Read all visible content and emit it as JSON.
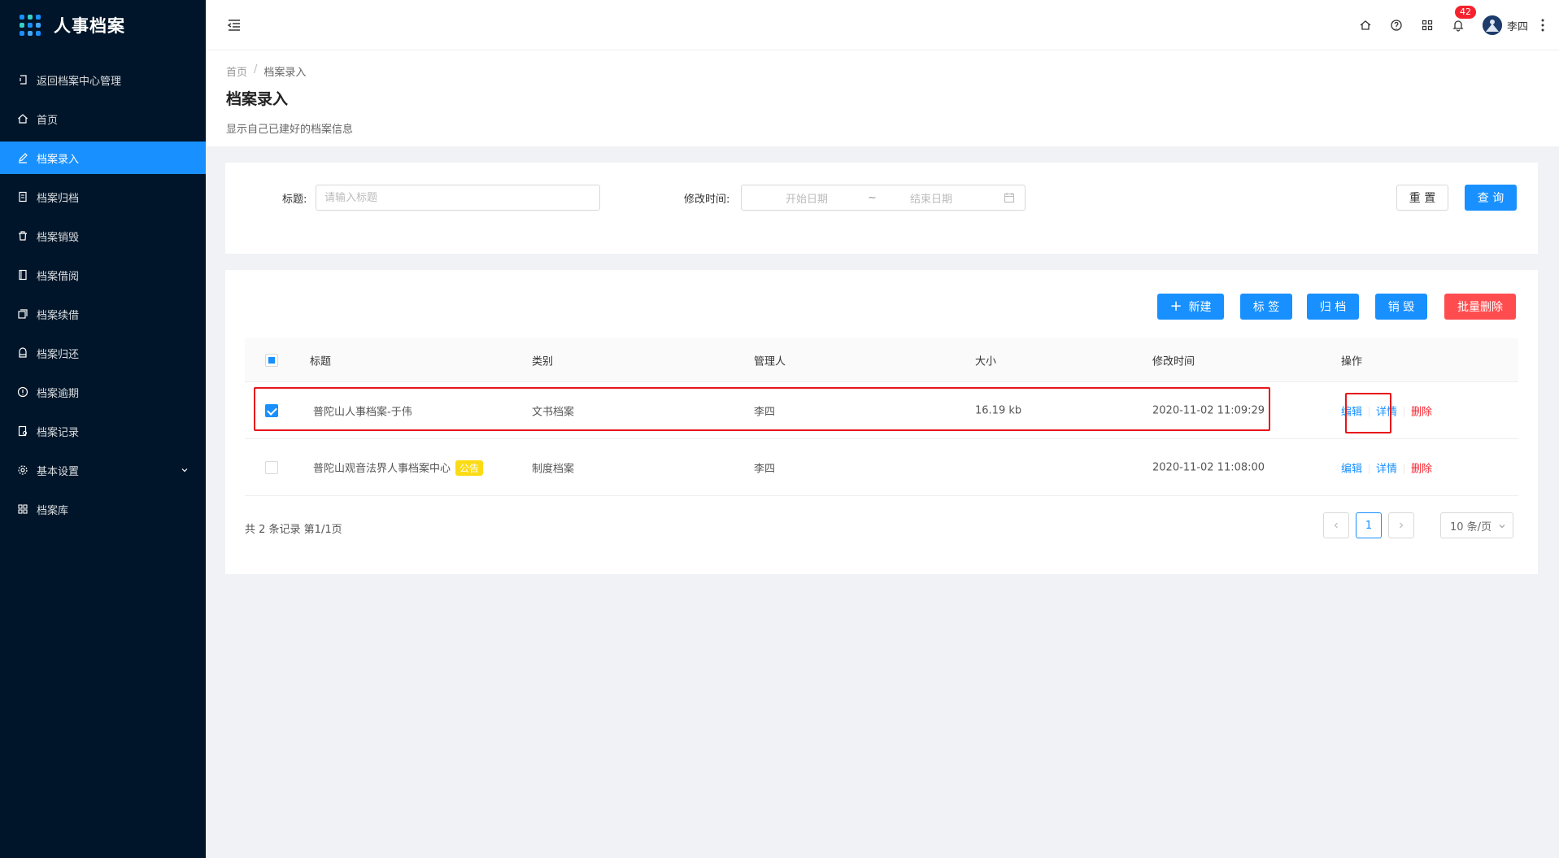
{
  "app": {
    "title": "人事档案"
  },
  "sidebar": {
    "items": [
      {
        "label": "返回档案中心管理",
        "icon": "return-icon"
      },
      {
        "label": "首页",
        "icon": "home-icon"
      },
      {
        "label": "档案录入",
        "icon": "edit-icon",
        "active": true
      },
      {
        "label": "档案归档",
        "icon": "file-icon"
      },
      {
        "label": "档案销毁",
        "icon": "trash-icon"
      },
      {
        "label": "档案借阅",
        "icon": "book-icon"
      },
      {
        "label": "档案续借",
        "icon": "copy-icon"
      },
      {
        "label": "档案归还",
        "icon": "inbox-icon"
      },
      {
        "label": "档案逾期",
        "icon": "alert-icon"
      },
      {
        "label": "档案记录",
        "icon": "record-icon"
      },
      {
        "label": "基本设置",
        "icon": "gear-icon",
        "expandable": true
      },
      {
        "label": "档案库",
        "icon": "grid-icon"
      }
    ]
  },
  "header": {
    "notification_count": "42",
    "username": "李四"
  },
  "page": {
    "breadcrumb": [
      "首页",
      "/",
      "档案录入"
    ],
    "title": "档案录入",
    "description": "显示自己已建好的档案信息"
  },
  "search": {
    "title_label": "标题:",
    "title_placeholder": "请输入标题",
    "time_label": "修改时间:",
    "start_placeholder": "开始日期",
    "range_sep": "~",
    "end_placeholder": "结束日期",
    "reset_label": "重 置",
    "query_label": "查 询"
  },
  "toolbar": {
    "new_label": "新建",
    "tag_label": "标 签",
    "archive_label": "归 档",
    "destroy_label": "销 毁",
    "batch_delete_label": "批量删除"
  },
  "table": {
    "columns": [
      "标题",
      "类别",
      "管理人",
      "大小",
      "修改时间",
      "操作"
    ],
    "rows": [
      {
        "checked": true,
        "title": "普陀山人事档案-于伟",
        "tag": "",
        "category": "文书档案",
        "manager": "李四",
        "size": "16.19 kb",
        "modified": "2020-11-02 11:09:29"
      },
      {
        "checked": false,
        "title": "普陀山观音法界人事档案中心",
        "tag": "公告",
        "category": "制度档案",
        "manager": "李四",
        "size": "",
        "modified": "2020-11-02 11:08:00"
      }
    ],
    "actions": {
      "edit": "编辑",
      "detail": "详情",
      "delete": "删除"
    }
  },
  "pagination": {
    "summary": "共 2 条记录 第1/1页",
    "current": "1",
    "page_size": "10 条/页"
  },
  "colors": {
    "sidebar_bg": "#001529",
    "primary": "#1890ff",
    "danger": "#ff4d4f",
    "highlight": "#e8141b",
    "tag": "#fadb14"
  }
}
